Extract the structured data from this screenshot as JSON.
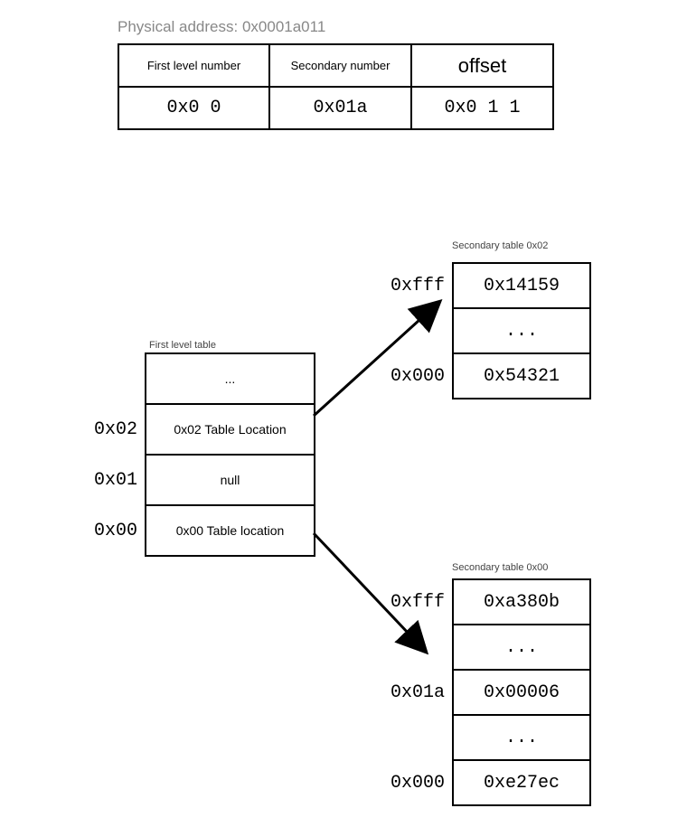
{
  "physical_address_label": "Physical address: 0x0001a011",
  "breakdown": {
    "headers": [
      "First level number",
      "Secondary number",
      "offset"
    ],
    "values": [
      "0x0  0",
      "0x01a",
      "0x0 1 1"
    ]
  },
  "first_level_table": {
    "title": "First level table",
    "rows": [
      {
        "index": "",
        "value": "..."
      },
      {
        "index": "0x02",
        "value": "0x02 Table Location"
      },
      {
        "index": "0x01",
        "value": "null"
      },
      {
        "index": "0x00",
        "value": "0x00 Table location"
      }
    ]
  },
  "secondary_tables": [
    {
      "title": "Secondary table 0x02",
      "rows": [
        {
          "index": "0xfff",
          "value": "0x14159"
        },
        {
          "index": "",
          "value": "..."
        },
        {
          "index": "0x000",
          "value": "0x54321"
        }
      ]
    },
    {
      "title": "Secondary table 0x00",
      "rows": [
        {
          "index": "0xfff",
          "value": "0xa380b"
        },
        {
          "index": "",
          "value": "..."
        },
        {
          "index": "0x01a",
          "value": "0x00006"
        },
        {
          "index": "",
          "value": "..."
        },
        {
          "index": "0x000",
          "value": "0xe27ec"
        }
      ]
    }
  ]
}
